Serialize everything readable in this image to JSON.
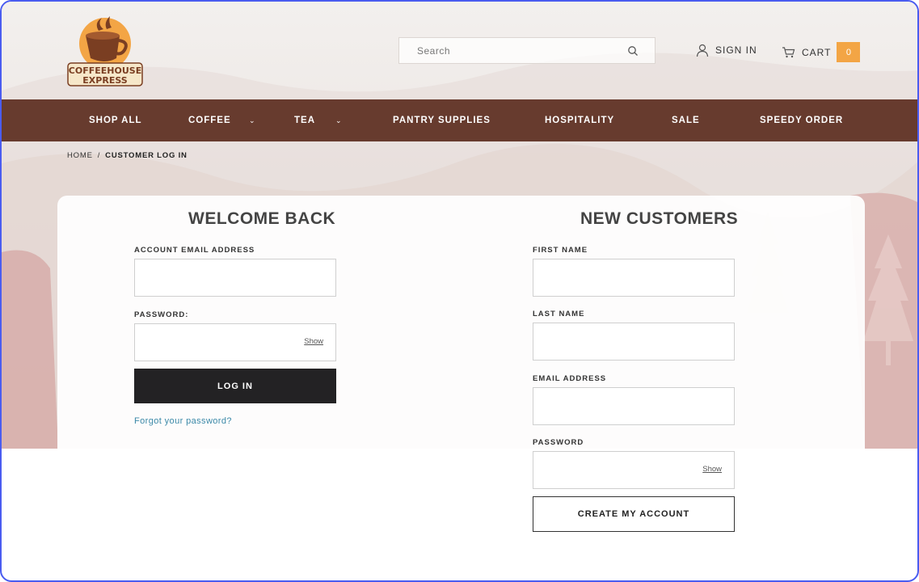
{
  "brand": {
    "logo_line1": "COFFEEHOUSE",
    "logo_line2": "EXPRESS",
    "accent": "#f3a545",
    "nav_bg": "#673b2e"
  },
  "header": {
    "search_placeholder": "Search",
    "signin_label": "SIGN IN",
    "cart_label": "CART",
    "cart_count": "0"
  },
  "nav": {
    "items": [
      {
        "label": "SHOP ALL"
      },
      {
        "label": "COFFEE",
        "has_dropdown": true
      },
      {
        "label": "TEA",
        "has_dropdown": true
      },
      {
        "label": "PANTRY SUPPLIES"
      },
      {
        "label": "HOSPITALITY"
      },
      {
        "label": "SALE"
      },
      {
        "label": "SPEEDY ORDER"
      }
    ]
  },
  "breadcrumb": {
    "home": "HOME",
    "separator": "/",
    "current": "CUSTOMER LOG IN"
  },
  "login": {
    "title": "WELCOME BACK",
    "email_label": "ACCOUNT EMAIL ADDRESS",
    "email_value": "",
    "password_label": "PASSWORD:",
    "password_value": "",
    "show_label": "Show",
    "button_label": "LOG IN",
    "forgot_label": "Forgot your password?"
  },
  "register": {
    "title": "NEW CUSTOMERS",
    "first_name_label": "FIRST NAME",
    "last_name_label": "LAST NAME",
    "email_label": "EMAIL ADDRESS",
    "password_label": "PASSWORD",
    "show_label": "Show",
    "button_label": "CREATE MY ACCOUNT"
  }
}
